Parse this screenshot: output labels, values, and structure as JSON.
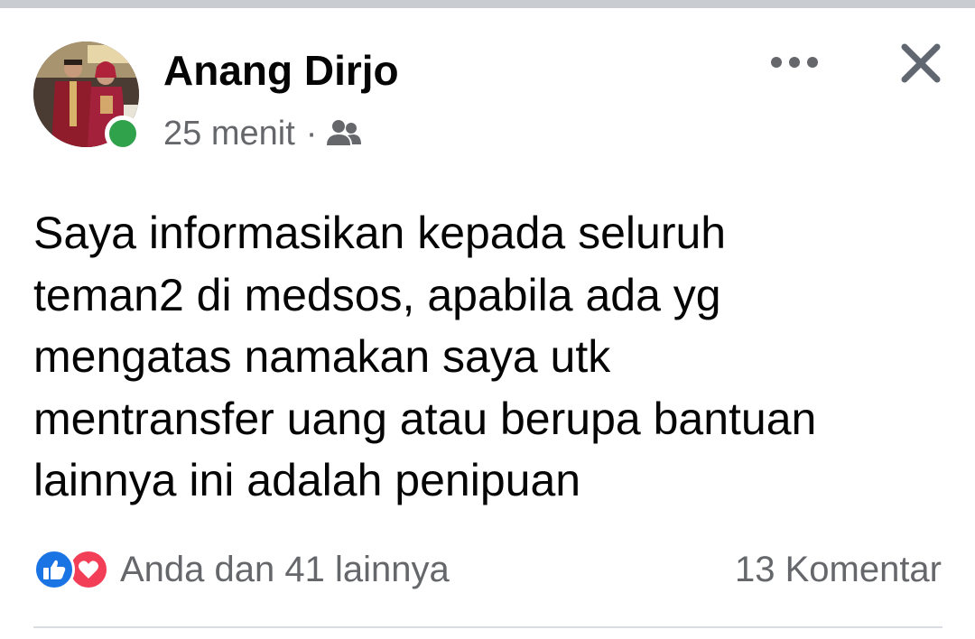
{
  "post": {
    "author_name": "Anang Dirjo",
    "timestamp": "25 menit",
    "separator": "·",
    "audience_icon": "friends-icon",
    "online_status_color": "#31a24c",
    "text_lines": [
      "Saya informasikan kepada seluruh",
      "teman2 di medsos, apabila ada yg",
      "mengatas namakan saya utk",
      "mentransfer uang atau berupa bantuan",
      "lainnya ini adalah penipuan"
    ]
  },
  "header_actions": {
    "more_icon": "more-horizontal-icon",
    "close_icon": "close-icon"
  },
  "footer": {
    "reaction_icons": [
      "like-icon",
      "love-icon"
    ],
    "reactions_summary": "Anda dan 41 lainnya",
    "comments_summary": "13 Komentar"
  },
  "colors": {
    "like": "#1b74e4",
    "love": "#f33e58",
    "secondary_text": "#65676b",
    "primary_text": "#050505"
  }
}
